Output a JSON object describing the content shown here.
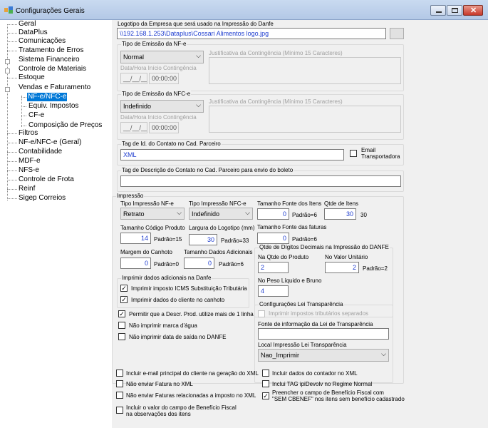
{
  "window": {
    "title": "Configurações Gerais"
  },
  "tree": {
    "items": [
      "Geral",
      "DataPlus",
      "Comunicações",
      "Tratamento de Erros",
      "Sistema Financeiro",
      "Controle de Materiais",
      "Estoque",
      "Vendas e Faturamento",
      "NF-e/NFC-e",
      "Equiv. Impostos",
      "CF-e",
      "Composição de Preços",
      "Filtros",
      "NF-e/NFC-e (Geral)",
      "Contabilidade",
      "MDF-e",
      "NFS-e",
      "Controle de Frota",
      "Reinf",
      "Sigep Correios"
    ]
  },
  "logo": {
    "label": "Logotipo da Empresa que será usado na Impressão do Danfe",
    "path": "\\\\192.168.1.253\\Dataplus\\Cossari Alimentos logo.jpg"
  },
  "nfe": {
    "group": "Tipo de Emissão da NF-e",
    "tipo": "Normal",
    "justificativa_label": "Justificativa da Contingência (Mínimo 15 Caracteres)",
    "data_label": "Data/Hora Início Contingência",
    "date": "__/__/____",
    "time": "00:00:00"
  },
  "nfce": {
    "group": "Tipo de Emissão da NFC-e",
    "tipo": "Indefinido",
    "justificativa_label": "Justificativa da Contingência (Mínimo 15 Caracteres)",
    "data_label": "Data/Hora Início Contingência",
    "date": "__/__/____",
    "time": "00:00:00"
  },
  "tag_contato": {
    "label": "Tag de Id. do Contato no Cad. Parceiro",
    "value": "XML",
    "email_label_1": "Email",
    "email_label_2": "Transportadora"
  },
  "tag_descricao": {
    "label": "Tag de Descrição do Contato no Cad. Parceiro para envio do boleto",
    "value": ""
  },
  "impressao": {
    "group": "Impressão",
    "tipo_nfe_label": "Tipo Impressão NF-e",
    "tipo_nfe": "Retrato",
    "tipo_nfce_label": "Tipo Impressão NFC-e",
    "tipo_nfce": "Indefinido",
    "tam_fonte_itens_label": "Tamanho Fonte dos Itens",
    "tam_fonte_itens": "0",
    "tam_fonte_itens_padrao": "Padrão=6",
    "qtde_itens_label": "Qtde de Itens",
    "qtde_itens": "30",
    "qtde_itens_padrao": "30",
    "tam_cod_label": "Tamanho Código Produto",
    "tam_cod": "14",
    "tam_cod_padrao": "Padrão=15",
    "larg_logo_label": "Largura do Logotipo (mm)",
    "larg_logo": "30",
    "larg_logo_padrao": "Padrão=33",
    "tam_fonte_faturas_label": "Tamanho Fonte das faturas",
    "tam_fonte_faturas": "0",
    "tam_fonte_faturas_padrao": "Padrão=6",
    "margem_label": "Margem do Canhoto",
    "margem": "0",
    "margem_padrao": "Padrão=0",
    "tam_dados_label": "Tamanho Dados Adicionais",
    "tam_dados": "0",
    "tam_dados_padrao": "Padrão=6",
    "dados_adic_group": "Imprimir dados adicionais na Danfe",
    "chk_icms": "Imprimir imposto ICMS Substituição Tributária",
    "chk_canhoto": "Imprimir dados do cliente no canhoto",
    "chk_descr": "Permitir que a Descr. Prod. utilize mais de 1 linha",
    "chk_agua": "Não imprimir marca d'água",
    "chk_saida": "Não imprimir data de saída no DANFE",
    "decimais_group": "Qtde de Dígitos Decimais na Impressão do DANFE",
    "qtde_prod_label": "Na Qtde do Produto",
    "qtde_prod": "2",
    "valor_unit_label": "No Valor Unitário",
    "valor_unit": "2",
    "valor_unit_padrao": "Padrão=2",
    "peso_label": "No Peso Líquido e Bruno",
    "peso": "4",
    "transp_group": "Configurações Lei Transparência",
    "chk_tributos": "Imprimir impostos tributários separados",
    "fonte_lei_label": "Fonte de informação da Lei de Transparência",
    "fonte_lei": "",
    "local_lei_label": "Local Impressão Lei Transparência",
    "local_lei": "Nao_Imprimir"
  },
  "bottom": {
    "chk_email": "Incluir e-mail principal do cliente na geração do XML",
    "chk_fatura": "Não enviar Fatura no XML",
    "chk_faturas_rel": "Não enviar Faturas relacionadas a imposto no XML",
    "chk_beneficio_1": "Incluir o valor do campo de Benefício Fiscal",
    "chk_beneficio_2": "na observações dos itens",
    "chk_contador": "Incluir dados do contador no XML",
    "chk_ipidevolv": "Inclui TAG ipiDevolv no Regime Normal",
    "chk_cbenef_1": "Preencher o campo de Benefício Fiscal com",
    "chk_cbenef_2": "\"SEM CBENEF\" nos itens sem benefício cadastrado"
  },
  "icons": {
    "check": "✓",
    "arrow": "⌵"
  }
}
